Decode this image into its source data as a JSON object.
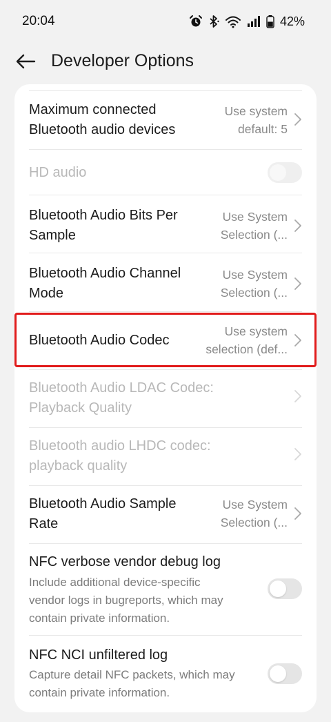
{
  "status": {
    "time": "20:04",
    "battery": "42%"
  },
  "header": {
    "title": "Developer Options"
  },
  "rows": {
    "max_devices": {
      "title_line1": "Maximum connected",
      "title_line2": "Bluetooth audio devices",
      "value_line1": "Use system",
      "value_line2": "default: 5"
    },
    "hd_audio": {
      "title": "HD audio"
    },
    "bits_per_sample": {
      "title_line1": "Bluetooth Audio Bits Per",
      "title_line2": "Sample",
      "value_line1": "Use System",
      "value_line2": "Selection (..."
    },
    "channel_mode": {
      "title_line1": "Bluetooth Audio Channel",
      "title_line2": "Mode",
      "value_line1": "Use System",
      "value_line2": "Selection (..."
    },
    "codec": {
      "title": "Bluetooth Audio Codec",
      "value_line1": "Use system",
      "value_line2": "selection (def..."
    },
    "ldac": {
      "title_line1": "Bluetooth Audio LDAC Codec:",
      "title_line2": "Playback Quality"
    },
    "lhdc": {
      "title_line1": "Bluetooth audio LHDC codec:",
      "title_line2": "playback quality"
    },
    "sample_rate": {
      "title_line1": "Bluetooth Audio Sample",
      "title_line2": "Rate",
      "value_line1": "Use System",
      "value_line2": "Selection (..."
    },
    "nfc_vendor": {
      "title": "NFC verbose vendor debug log",
      "desc_line1": "Include additional device-specific",
      "desc_line2": "vendor logs in bugreports, which may",
      "desc_line3": "contain private information."
    },
    "nfc_nci": {
      "title": "NFC NCI unfiltered log",
      "desc_line1": "Capture detail NFC packets, which may",
      "desc_line2": "contain private information."
    }
  },
  "colors": {
    "background": "#f2f2f2",
    "card": "#ffffff",
    "highlight": "#e11b1b",
    "disabled_text": "#b8b8b8",
    "secondary_text": "#8a8a8a"
  }
}
